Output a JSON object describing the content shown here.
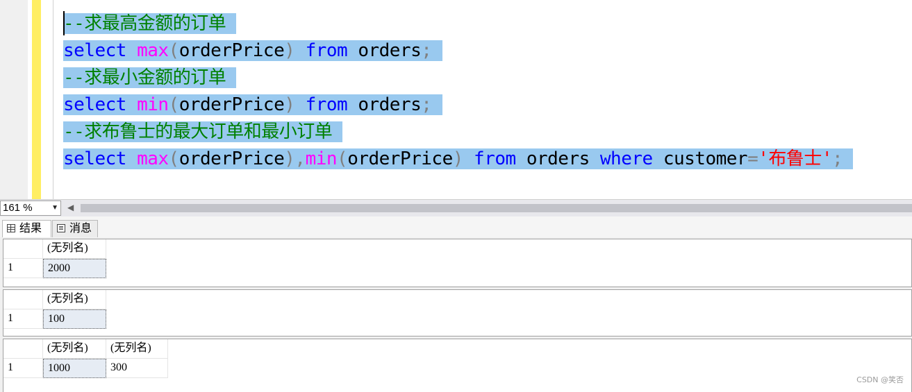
{
  "editor": {
    "lines": [
      [
        {
          "t": "--求最高金额的订单",
          "c": "cm"
        }
      ],
      [
        {
          "t": "select",
          "c": "kw"
        },
        {
          "t": " ",
          "c": "tx"
        },
        {
          "t": "max",
          "c": "fn"
        },
        {
          "t": "(",
          "c": "op"
        },
        {
          "t": "orderPrice",
          "c": "tx"
        },
        {
          "t": ")",
          "c": "op"
        },
        {
          "t": " ",
          "c": "tx"
        },
        {
          "t": "from",
          "c": "kw"
        },
        {
          "t": " orders",
          "c": "tx"
        },
        {
          "t": ";",
          "c": "op"
        }
      ],
      [
        {
          "t": "--求最小金额的订单",
          "c": "cm"
        }
      ],
      [
        {
          "t": "select",
          "c": "kw"
        },
        {
          "t": " ",
          "c": "tx"
        },
        {
          "t": "min",
          "c": "fn"
        },
        {
          "t": "(",
          "c": "op"
        },
        {
          "t": "orderPrice",
          "c": "tx"
        },
        {
          "t": ")",
          "c": "op"
        },
        {
          "t": " ",
          "c": "tx"
        },
        {
          "t": "from",
          "c": "kw"
        },
        {
          "t": " orders",
          "c": "tx"
        },
        {
          "t": ";",
          "c": "op"
        }
      ],
      [
        {
          "t": "--求布鲁士的最大订单和最小订单",
          "c": "cm"
        }
      ],
      [
        {
          "t": "select",
          "c": "kw"
        },
        {
          "t": " ",
          "c": "tx"
        },
        {
          "t": "max",
          "c": "fn"
        },
        {
          "t": "(",
          "c": "op"
        },
        {
          "t": "orderPrice",
          "c": "tx"
        },
        {
          "t": "),",
          "c": "op"
        },
        {
          "t": "min",
          "c": "fn"
        },
        {
          "t": "(",
          "c": "op"
        },
        {
          "t": "orderPrice",
          "c": "tx"
        },
        {
          "t": ")",
          "c": "op"
        },
        {
          "t": " ",
          "c": "tx"
        },
        {
          "t": "from",
          "c": "kw"
        },
        {
          "t": " orders ",
          "c": "tx"
        },
        {
          "t": "where",
          "c": "kw"
        },
        {
          "t": " customer",
          "c": "tx"
        },
        {
          "t": "=",
          "c": "op"
        },
        {
          "t": "'布鲁士'",
          "c": "str"
        },
        {
          "t": ";",
          "c": "op"
        }
      ]
    ]
  },
  "zoom": {
    "value": "161 %"
  },
  "tabs": {
    "results": "结果",
    "messages": "消息"
  },
  "result_sets": [
    {
      "columns": [
        "(无列名)"
      ],
      "rows": [
        {
          "num": "1",
          "values": [
            "2000"
          ]
        }
      ]
    },
    {
      "columns": [
        "(无列名)"
      ],
      "rows": [
        {
          "num": "1",
          "values": [
            "100"
          ]
        }
      ]
    },
    {
      "columns": [
        "(无列名)",
        "(无列名)"
      ],
      "rows": [
        {
          "num": "1",
          "values": [
            "1000",
            "300"
          ]
        }
      ]
    }
  ],
  "watermark": "CSDN @笑否",
  "colors": {
    "keyword": "#0000ff",
    "function": "#ff00ff",
    "comment": "#008000",
    "string": "#ff0000",
    "selection": "#99c9ef"
  }
}
